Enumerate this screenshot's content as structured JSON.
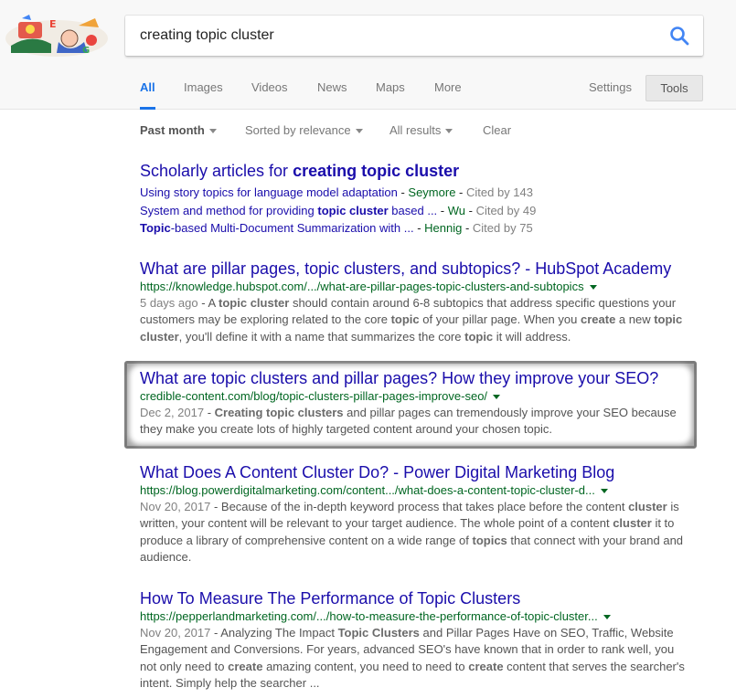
{
  "search": {
    "query": "creating topic cluster"
  },
  "tabs": [
    {
      "label": "All",
      "active": true
    },
    {
      "label": "Images"
    },
    {
      "label": "Videos"
    },
    {
      "label": "News"
    },
    {
      "label": "Maps"
    },
    {
      "label": "More"
    }
  ],
  "settings_label": "Settings",
  "tools_label": "Tools",
  "filters": {
    "time": "Past month",
    "sort": "Sorted by relevance",
    "all_results": "All results",
    "clear": "Clear"
  },
  "scholarly": {
    "title_prefix": "Scholarly articles for ",
    "title_query": "creating topic cluster",
    "items": [
      {
        "title_html": "Using story topics for language model adaptation",
        "author": "Seymore",
        "cited": "Cited by 143"
      },
      {
        "title_html": "System and method for providing <b>topic cluster</b> based ...",
        "author": "Wu",
        "cited": "Cited by 49"
      },
      {
        "title_html": "<b>Topic</b>-based Multi-Document Summarization with ...",
        "author": "Hennig",
        "cited": "Cited by 75"
      }
    ]
  },
  "results": [
    {
      "title": "What are pillar pages, topic clusters, and subtopics? - HubSpot Academy",
      "url": "https://knowledge.hubspot.com/.../what-are-pillar-pages-topic-clusters-and-subtopics",
      "date": "5 days ago",
      "snippet_html": "A <b>topic cluster</b> should contain around 6-8 subtopics that address specific questions your customers may be exploring related to the core <b>topic</b> of your pillar page. When you <b>create</b> a new <b>topic cluster</b>, you'll define it with a name that summarizes the core <b>topic</b> it will address."
    },
    {
      "title": "What are topic clusters and pillar pages? How they improve your SEO?",
      "url": "credible-content.com/blog/topic-clusters-pillar-pages-improve-seo/",
      "date": "Dec 2, 2017",
      "snippet_html": "<b>Creating topic clusters</b> and pillar pages can tremendously improve your SEO because they make you create lots of highly targeted content around your chosen topic.",
      "highlighted": true
    },
    {
      "title": "What Does A Content Cluster Do? - Power Digital Marketing Blog",
      "url": "https://blog.powerdigitalmarketing.com/content.../what-does-a-content-topic-cluster-d...",
      "date": "Nov 20, 2017",
      "snippet_html": "Because of the in-depth keyword process that takes place before the content <b>cluster</b> is written, your content will be relevant to your target audience. The whole point of a content <b>cluster</b> it to produce a library of comprehensive content on a wide range of <b>topics</b> that connect with your brand and audience."
    },
    {
      "title": "How To Measure The Performance of Topic Clusters",
      "url": "https://pepperlandmarketing.com/.../how-to-measure-the-performance-of-topic-cluster...",
      "date": "Nov 20, 2017",
      "snippet_html": "Analyzing The Impact <b>Topic Clusters</b> and Pillar Pages Have on SEO, Traffic, Website Engagement and Conversions. For years, advanced SEO's have known that in order to rank well, you not only need to <b>create</b> amazing content, you need to need to <b>create</b> content that serves the searcher's intent. Simply help the searcher ..."
    }
  ]
}
